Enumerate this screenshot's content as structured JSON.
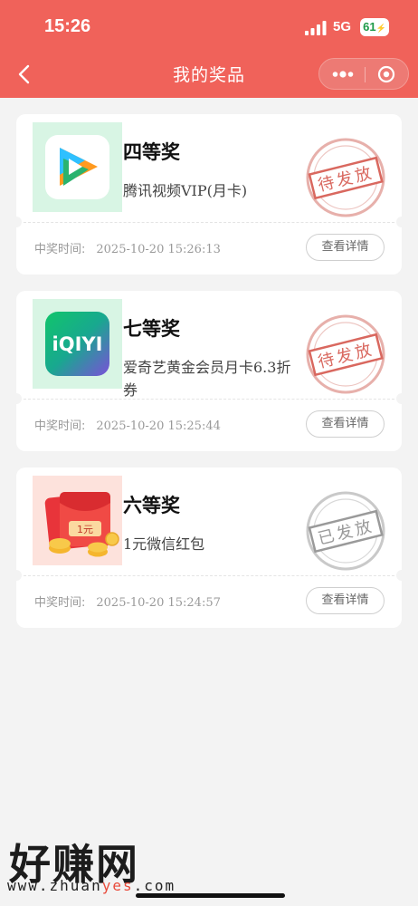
{
  "status_bar": {
    "time": "15:26",
    "network": "5G",
    "battery": "61"
  },
  "nav": {
    "title": "我的奖品"
  },
  "prizes": [
    {
      "level": "四等奖",
      "name": "腾讯视频VIP(月卡)",
      "time_label": "中奖时间:",
      "time": "2025-10-20 15:26:13",
      "stamp": "待发放",
      "detail": "查看详情",
      "logo": "tencent-video-logo"
    },
    {
      "level": "七等奖",
      "name": "爱奇艺黄金会员月卡6.3折券",
      "time_label": "中奖时间:",
      "time": "2025-10-20 15:25:44",
      "stamp": "待发放",
      "detail": "查看详情",
      "logo": "iqiyi-logo",
      "logo_text": "iQIYI"
    },
    {
      "level": "六等奖",
      "name": "1元微信红包",
      "time_label": "中奖时间:",
      "time": "2025-10-20 15:24:57",
      "stamp": "已发放",
      "detail": "查看详情",
      "logo": "red-packet",
      "logo_text": "1元"
    }
  ],
  "watermark": {
    "text": "好赚网",
    "url_prefix": "www.zhuan",
    "url_highlight": "yes",
    "url_suffix": ".com"
  },
  "colors": {
    "header": "#f0625a",
    "stamp_pending": "#d9685f",
    "stamp_issued": "#9a9a9a"
  }
}
